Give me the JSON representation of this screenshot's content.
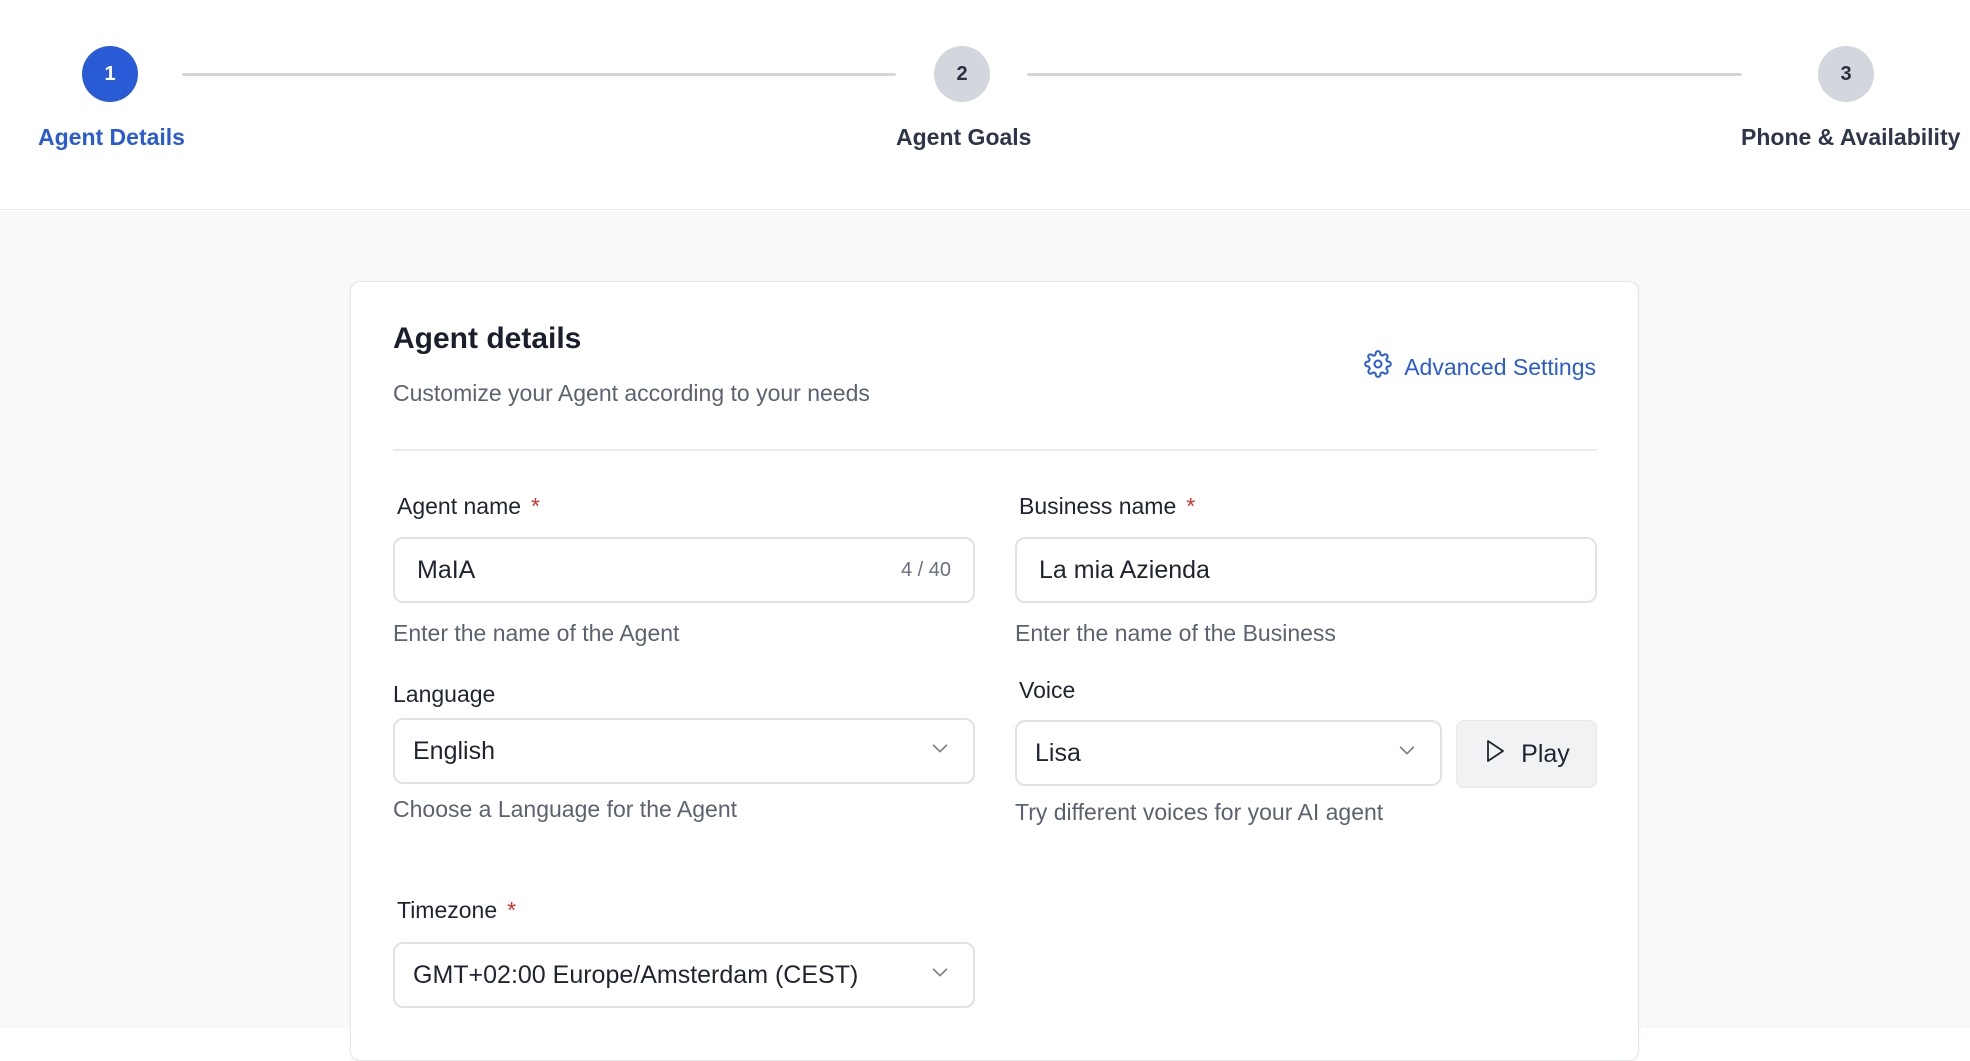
{
  "stepper": {
    "steps": [
      {
        "number": "1",
        "label": "Agent Details",
        "state": "active"
      },
      {
        "number": "2",
        "label": "Agent Goals",
        "state": "inactive"
      },
      {
        "number": "3",
        "label": "Phone & Availability",
        "state": "inactive"
      }
    ]
  },
  "card": {
    "title": "Agent details",
    "subtitle": "Customize your Agent according to your needs",
    "advanced_settings_label": "Advanced Settings",
    "advanced_settings_icon": "gear-icon"
  },
  "fields": {
    "agent_name": {
      "label": "Agent name",
      "required_mark": "*",
      "value": "MaIA",
      "counter": "4 / 40",
      "helper": "Enter the name of the Agent"
    },
    "business_name": {
      "label": "Business name",
      "required_mark": "*",
      "value": "La mia Azienda",
      "helper": "Enter the name of the Business"
    },
    "language": {
      "label": "Language",
      "value": "English",
      "helper": "Choose a Language for the Agent"
    },
    "voice": {
      "label": "Voice",
      "value": "Lisa",
      "helper": "Try different voices for your AI agent",
      "play_label": "Play"
    },
    "timezone": {
      "label": "Timezone",
      "required_mark": "*",
      "value": "GMT+02:00 Europe/Amsterdam (CEST)"
    }
  },
  "colors": {
    "accent": "#2a5bd7",
    "required": "#d0342c",
    "inactive_step": "#d3d6dc"
  }
}
